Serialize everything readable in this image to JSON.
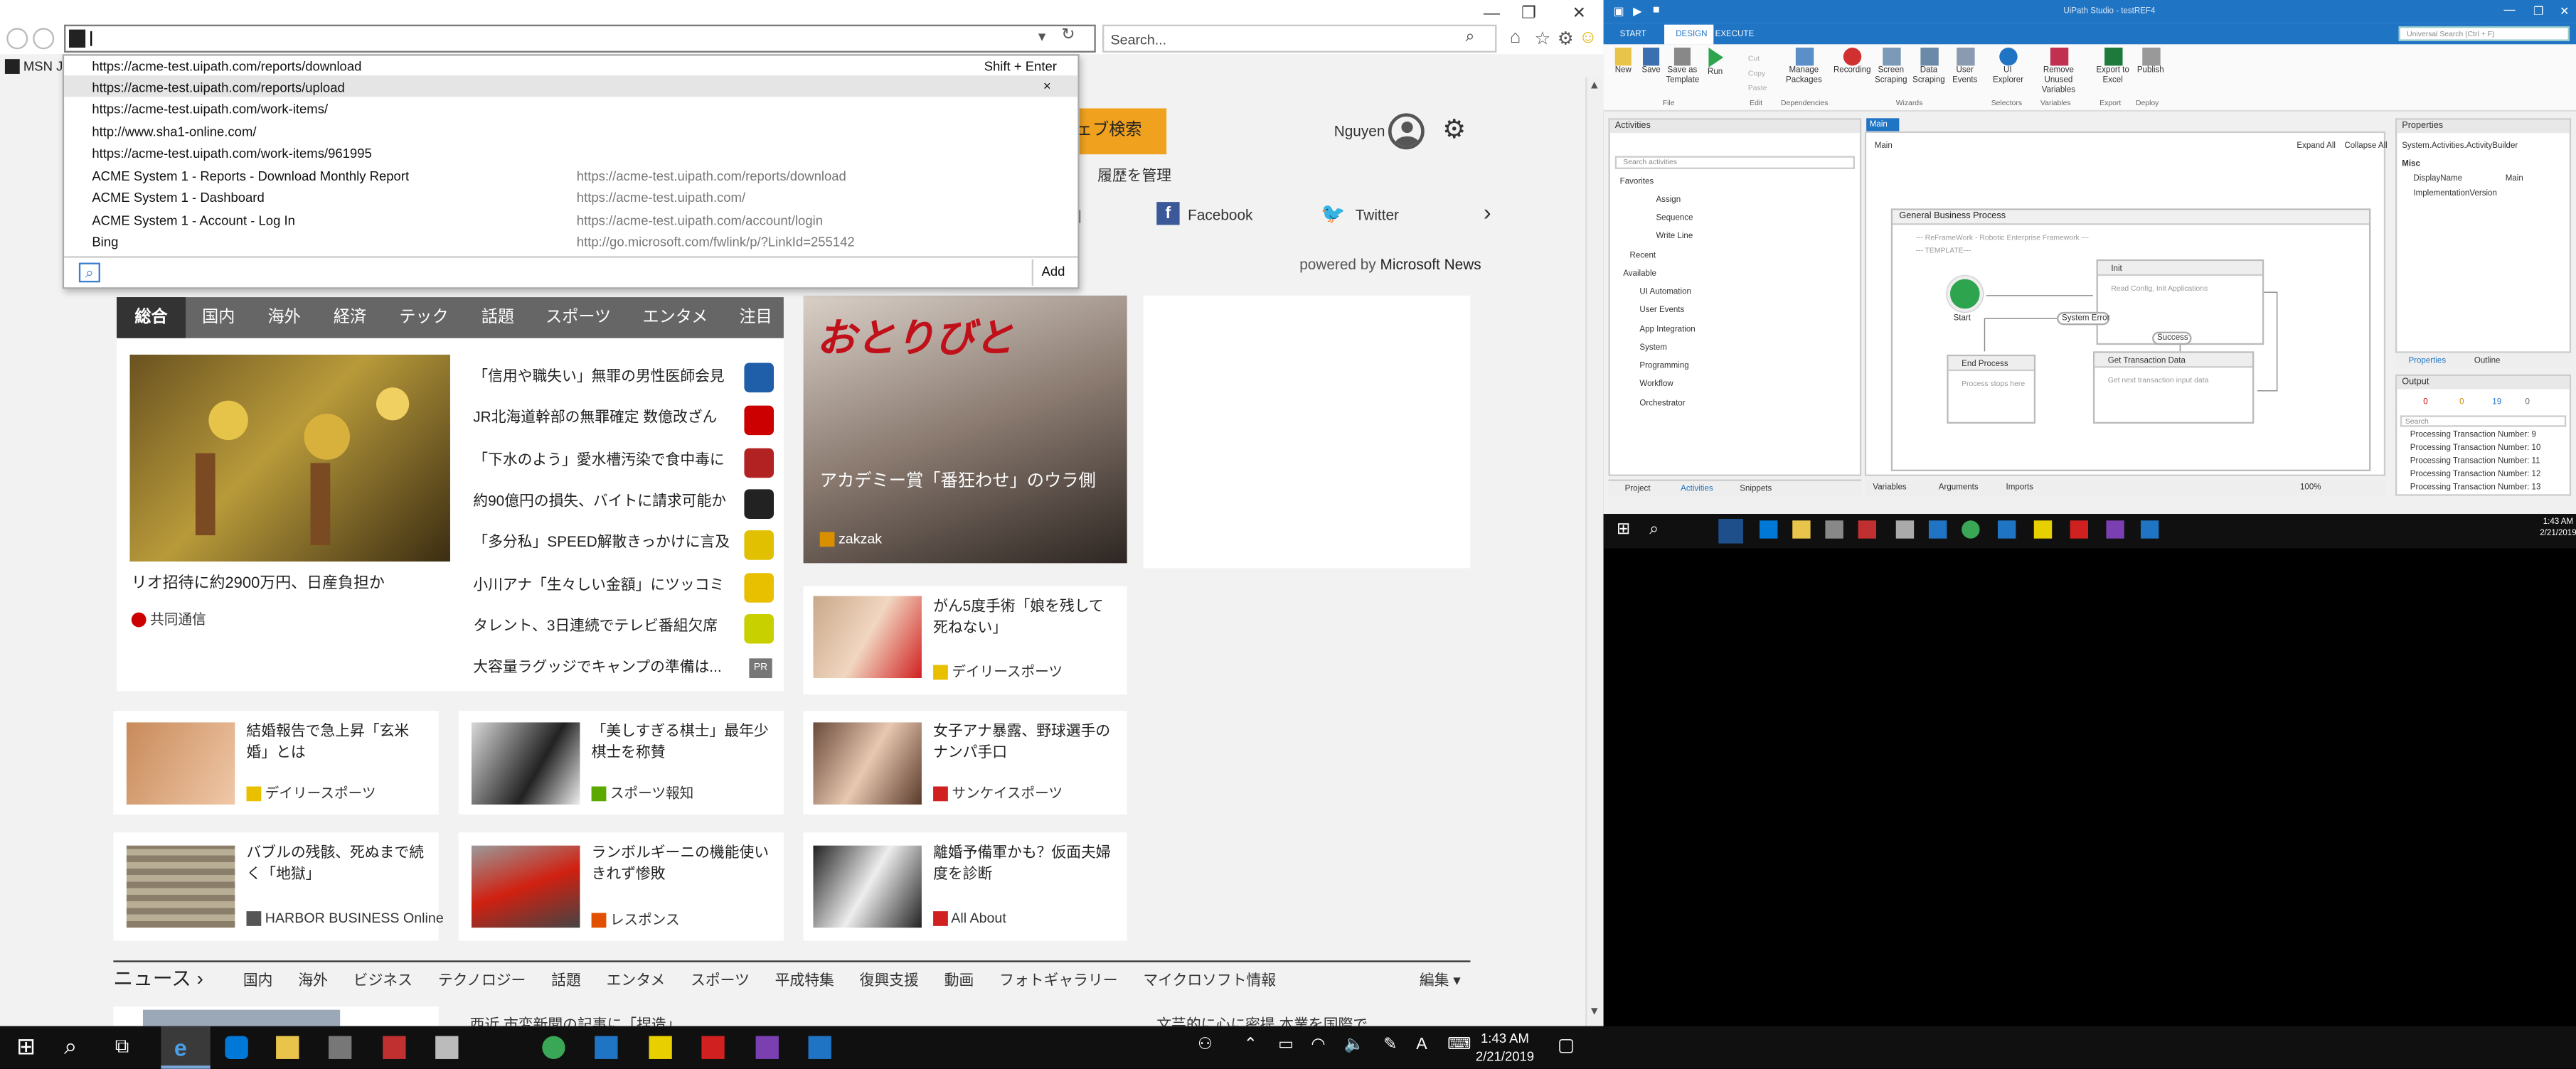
{
  "ie": {
    "search_placeholder": "Search...",
    "msn_partial": "MSN Ja",
    "dropdown": {
      "items": [
        {
          "left": "https://acme-test.uipath.com/reports/download",
          "right": "Shift + Enter"
        },
        {
          "left": "https://acme-test.uipath.com/reports/upload",
          "right": "×"
        },
        {
          "left": "https://acme-test.uipath.com/work-items/",
          "right": ""
        },
        {
          "left": "http://www.sha1-online.com/",
          "right": ""
        },
        {
          "left": "https://acme-test.uipath.com/work-items/961995",
          "right": ""
        }
      ],
      "history": [
        {
          "title": "ACME System 1 - Reports - Download Monthly Report",
          "url": "https://acme-test.uipath.com/reports/download"
        },
        {
          "title": "ACME System 1 - Dashboard",
          "url": "https://acme-test.uipath.com/"
        },
        {
          "title": "ACME System 1 - Account - Log In",
          "url": "https://acme-test.uipath.com/account/login"
        },
        {
          "title": "Bing",
          "url": "http://go.microsoft.com/fwlink/p/?LinkId=255142"
        }
      ],
      "add_label": "Add"
    }
  },
  "msn": {
    "web_search_btn": "ウェブ検索",
    "history_link": "履歴を管理",
    "user_name": "Nguyen",
    "facebook": "Facebook",
    "twitter": "Twitter",
    "powered_by_prefix": "powered by",
    "powered_by_brand": "Microsoft News",
    "tabs": [
      "総合",
      "国内",
      "海外",
      "経済",
      "テック",
      "話題",
      "スポーツ",
      "エンタメ",
      "注目"
    ],
    "main_story": {
      "title": "リオ招待に約2900万円、日産負担か",
      "source": "共同通信"
    },
    "headlines": [
      "「信用や職失い」無罪の男性医師会見",
      "JR北海道幹部の無罪確定 数億改ざん",
      "「下水のよう」愛水槽汚染で食中毒に",
      "約90億円の損失、バイトに請求可能か",
      "「多分私」SPEED解散きっかけに言及",
      "小川アナ「生々しい金額」にツッコミ",
      "タレント、3日連続でテレビ番組欠席",
      "大容量ラグッジでキャンプの準備は..."
    ],
    "pr_label": "PR",
    "featured": {
      "title": "アカデミー賞「番狂わせ」のウラ側",
      "source": "zakzak"
    },
    "side_story": {
      "title": "がん5度手術「娘を残して死ねない」",
      "source": "デイリースポーツ"
    },
    "cards": [
      {
        "title": "結婚報告で急上昇「玄米婚」とは",
        "source": "デイリースポーツ"
      },
      {
        "title": "「美しすぎる棋士」最年少棋士を称賛",
        "source": "スポーツ報知"
      },
      {
        "title": "女子アナ暴露、野球選手のナンパ手口",
        "source": "サンケイスポーツ"
      },
      {
        "title": "バブルの残骸、死ぬまで続く「地獄」",
        "source": "HARBOR BUSINESS Online"
      },
      {
        "title": "ランボルギーニの機能使いきれず惨敗",
        "source": "レスポンス"
      },
      {
        "title": "離婚予備軍かも？仮面夫婦度を診断",
        "source": "All About"
      }
    ],
    "news_bar": {
      "title": "ニュース",
      "items": [
        "国内",
        "海外",
        "ビジネス",
        "テクノロジー",
        "話題",
        "エンタメ",
        "スポーツ",
        "平成特集",
        "復興支援",
        "動画",
        "フォトギャラリー",
        "マイクロソフト情報"
      ],
      "edit": "編集"
    },
    "bottom_partial_left": "西近 市変新聞の記事に「捏造」",
    "bottom_partial_right": "文芸的に心に密提 本業を国際で"
  },
  "taskbar": {
    "time": "1:43 AM",
    "date": "2/21/2019"
  },
  "uipath": {
    "title": "UiPath Studio - testREF4",
    "search_placeholder": "Universal Search (Ctrl + F)",
    "ribbon_tabs": [
      "START",
      "DESIGN",
      "EXECUTE"
    ],
    "ribbon_buttons": [
      "New",
      "Save",
      "Save as Template",
      "Run",
      "Cut",
      "Copy",
      "Paste",
      "Manage Packages",
      "Recording",
      "Screen Scraping",
      "Data Scraping",
      "User Events",
      "UI Explorer",
      "Remove Unused Variables",
      "Export to Excel",
      "Publish"
    ],
    "groups": [
      "File",
      "Edit",
      "Dependencies",
      "Wizards",
      "Selectors",
      "Variables",
      "Export",
      "Deploy"
    ],
    "activities_title": "Activities",
    "activities_search": "Search activities",
    "tree": [
      "Favorites",
      "Assign",
      "Sequence",
      "Write Line",
      "Recent",
      "Available",
      "UI Automation",
      "User Events",
      "App Integration",
      "System",
      "Programming",
      "Workflow",
      "Orchestrator"
    ],
    "doc_tab": "Main",
    "breadcrumb": "Main",
    "expand_all": "Expand All",
    "collapse_all": "Collapse All",
    "flow": {
      "title": "General Business Process",
      "comment1": "--- ReFrameWork - Robotic Enterprise Framework ---",
      "comment2": "--- TEMPLATE---",
      "start": "Start",
      "init": "Init",
      "init_desc": "Read Config, Init Applications",
      "system_error": "System Error",
      "success": "Success",
      "end": "End Process",
      "end_desc": "Process stops here",
      "get_tx": "Get Transaction Data",
      "get_tx_desc": "Get next transaction input data"
    },
    "bottom_tabs": [
      "Project",
      "Activities",
      "Snippets"
    ],
    "designer_tabs": [
      "Variables",
      "Arguments",
      "Imports"
    ],
    "zoom": "100%",
    "properties_title": "Properties",
    "properties_type": "System.Activities.ActivityBuilder",
    "prop_section": "Misc",
    "props": [
      {
        "name": "DisplayName",
        "value": "Main"
      },
      {
        "name": "ImplementationVersion",
        "value": ""
      }
    ],
    "prop_tabs": [
      "Properties",
      "Outline"
    ],
    "output_title": "Output",
    "output_counts": [
      "0",
      "0",
      "19",
      "0"
    ],
    "output_search": "Search",
    "output_lines": [
      "Processing Transaction Number: 9",
      "Processing Transaction Number: 10",
      "Processing Transaction Number: 11",
      "Processing Transaction Number: 12",
      "Processing Transaction Number: 13"
    ]
  },
  "colors": {
    "uipath_blue": "#1f74c4",
    "msn_orange": "#f0a21f",
    "taskbar": "#101010",
    "ie_bg": "#f2f2f2"
  }
}
